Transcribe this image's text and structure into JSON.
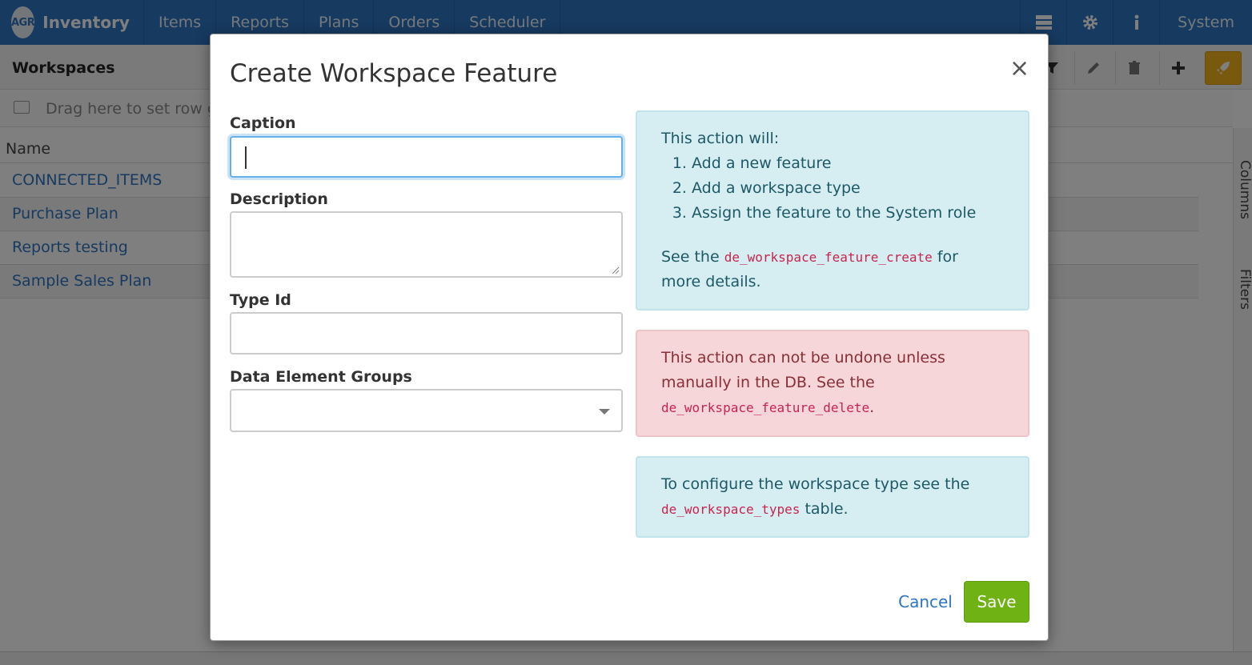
{
  "navbar": {
    "logo_text": "AGR",
    "brand": "Inventory",
    "items": [
      "Items",
      "Reports",
      "Plans",
      "Orders",
      "Scheduler"
    ],
    "user": "System",
    "color": "#2f74c0"
  },
  "subbar": {
    "title": "Workspaces"
  },
  "grid": {
    "group_placeholder": "Drag here to set row groups",
    "column_header": "Name",
    "rows": [
      "CONNECTED_ITEMS",
      "Purchase Plan",
      "Reports testing",
      "Sample Sales Plan"
    ],
    "side_columns_label": "Columns",
    "side_filters_label": "Filters"
  },
  "modal": {
    "title": "Create Workspace Feature",
    "close_symbol": "×",
    "fields": {
      "caption_label": "Caption",
      "caption_value": "",
      "description_label": "Description",
      "description_value": "",
      "type_id_label": "Type Id",
      "type_id_value": "",
      "data_element_groups_label": "Data Element Groups",
      "data_element_groups_value": ""
    },
    "info": {
      "intro": "This action will:",
      "steps": [
        "Add a new feature",
        "Add a workspace type",
        "Assign the feature to the System role"
      ],
      "see_prefix": "See the",
      "see_code": "de_workspace_feature_create",
      "see_suffix_1": "for",
      "see_suffix_2": "more details."
    },
    "danger": {
      "line1": "This action can not be undone unless",
      "line2": "manually in the DB. See the",
      "code": "de_workspace_feature_delete",
      "period": "."
    },
    "config": {
      "prefix": "To configure the workspace type see the",
      "code": "de_workspace_types",
      "suffix": "table."
    },
    "buttons": {
      "cancel": "Cancel",
      "save": "Save",
      "save_color": "#6fb214"
    }
  }
}
